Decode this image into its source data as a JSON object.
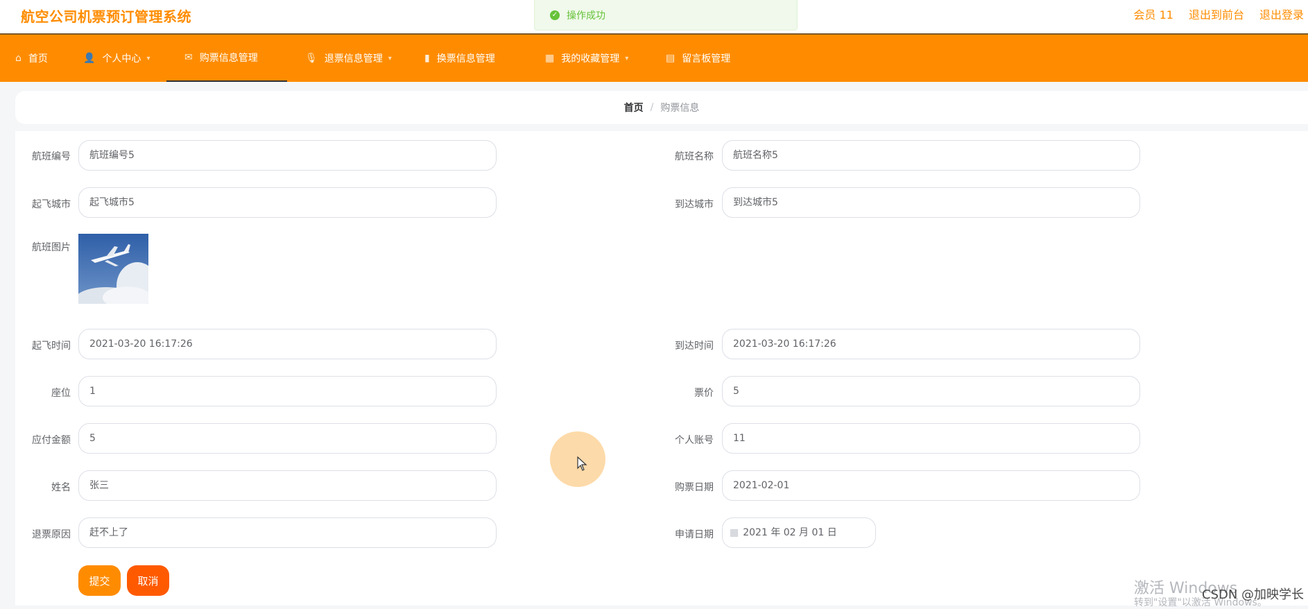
{
  "app": {
    "title": "航空公司机票预订管理系统"
  },
  "toast": {
    "message": "操作成功"
  },
  "user_menu": [
    "会员 11",
    "退出到前台",
    "退出登录"
  ],
  "nav": [
    {
      "label": "首页",
      "icon": "home-icon"
    },
    {
      "label": "个人中心",
      "icon": "user-icon"
    },
    {
      "label": "购票信息管理",
      "icon": "mail-icon"
    },
    {
      "label": "退票信息管理",
      "icon": "microphone-icon"
    },
    {
      "label": "换票信息管理",
      "icon": "bar-chart-icon"
    },
    {
      "label": "我的收藏管理",
      "icon": "grid-icon"
    },
    {
      "label": "留言板管理",
      "icon": "clipboard-icon"
    }
  ],
  "breadcrumb": {
    "home": "首页",
    "current": "购票信息"
  },
  "form": {
    "flight_no": {
      "label": "航班编号",
      "value": "航班编号5"
    },
    "flight_name": {
      "label": "航班名称",
      "value": "航班名称5"
    },
    "from_city": {
      "label": "起飞城市",
      "value": "起飞城市5"
    },
    "to_city": {
      "label": "到达城市",
      "value": "到达城市5"
    },
    "flight_image": {
      "label": "航班图片"
    },
    "depart_time": {
      "label": "起飞时间",
      "value": "2021-03-20 16:17:26"
    },
    "arrive_time": {
      "label": "到达时间",
      "value": "2021-03-20 16:17:26"
    },
    "seat": {
      "label": "座位",
      "value": "1"
    },
    "price": {
      "label": "票价",
      "value": "5"
    },
    "amount_due": {
      "label": "应付金额",
      "value": "5"
    },
    "account": {
      "label": "个人账号",
      "value": "11"
    },
    "name": {
      "label": "姓名",
      "value": "张三"
    },
    "purchase_date": {
      "label": "购票日期",
      "value": "2021-02-01"
    },
    "refund_reason": {
      "label": "退票原因",
      "value": "赶不上了"
    },
    "apply_date": {
      "label": "申请日期",
      "value": "2021 年 02 月 01 日"
    }
  },
  "buttons": {
    "submit": "提交",
    "cancel": "取消"
  },
  "colors": {
    "brand": "#ff8c00",
    "submit": "#ff8c00",
    "cancel": "#ff5a00",
    "success": "#67c23a"
  },
  "watermark": {
    "line1": "激活 Windows",
    "line2": "转到\"设置\"以激活 Windows。",
    "csdn": "CSDN @加映学长"
  }
}
